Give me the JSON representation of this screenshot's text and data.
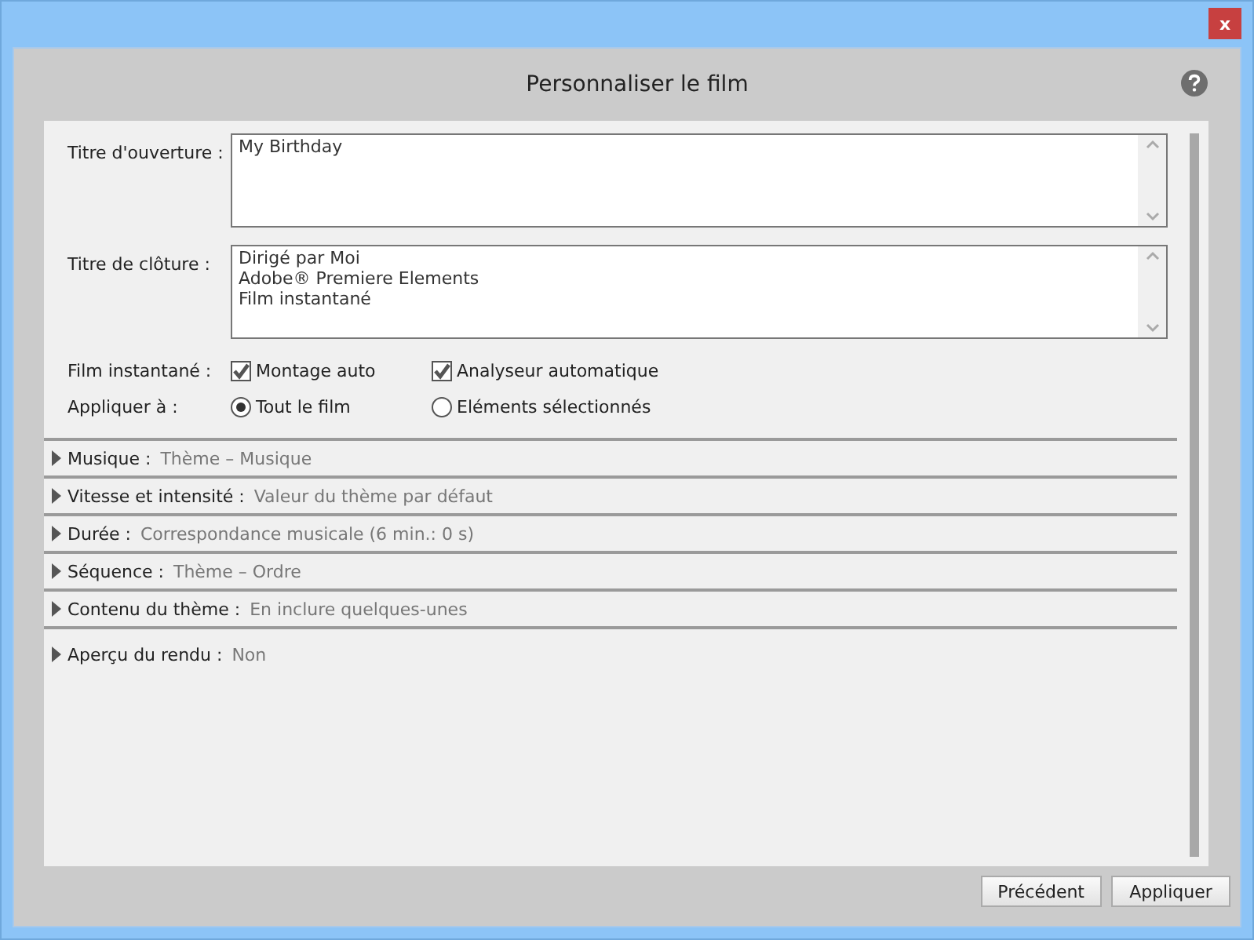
{
  "window": {
    "title": "Personnaliser le film",
    "close": "x"
  },
  "fields": [
    {
      "label": "Titre d'ouverture :",
      "value": "My Birthday"
    },
    {
      "label": "Titre de clôture :",
      "value": "Dirigé par Moi\nAdobe® Premiere Elements\nFilm instantané"
    }
  ],
  "instant_movie": {
    "label": "Film instantané :",
    "options": [
      {
        "label": "Montage auto",
        "checked": true
      },
      {
        "label": "Analyseur automatique",
        "checked": true
      }
    ]
  },
  "apply_to": {
    "label": "Appliquer à :",
    "options": [
      {
        "label": "Tout le film",
        "selected": true
      },
      {
        "label": "Eléments sélectionnés",
        "selected": false
      }
    ]
  },
  "sections": [
    {
      "label": "Musique :",
      "value": "Thème – Musique",
      "expanded": false
    },
    {
      "label": "Vitesse et intensité :",
      "value": "Valeur du thème par défaut",
      "expanded": false
    },
    {
      "label": "Durée :",
      "value": "Correspondance musicale (6 min.: 0 s)",
      "expanded": false
    },
    {
      "label": "Séquence :",
      "value": "Thème – Ordre",
      "expanded": false
    },
    {
      "label": "Contenu du thème :",
      "value": "En inclure quelques-unes",
      "expanded": false
    },
    {
      "label": "Aperçu du rendu :",
      "value": "Non",
      "expanded": false
    }
  ],
  "buttons": [
    "Précédent",
    "Appliquer"
  ]
}
